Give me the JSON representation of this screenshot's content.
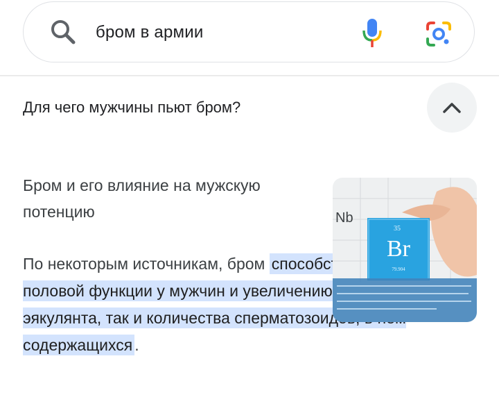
{
  "search": {
    "query": "бром в армии"
  },
  "question": {
    "text": "Для чего мужчины пьют бром?",
    "expanded": true
  },
  "answer": {
    "title": "Бром и его влияние на мужскую потенцию",
    "intro": "По некоторым источникам, бром ",
    "highlight": "способствует активизации половой функции у мужчин и увеличению как объёма эякулянта, так и количества сперматозоидов, в нём содержащихся",
    "end": ".",
    "image": {
      "element_symbol": "Br",
      "atomic_number": "35",
      "atomic_mass": "79.904",
      "corner_text": "Nb"
    }
  },
  "colors": {
    "highlight": "#d3e3fd",
    "mic_blue": "#4285f4",
    "mic_red": "#ea4335",
    "mic_green": "#34a853",
    "mic_yellow": "#fbbc05",
    "element_tile": "#29a3e0"
  }
}
